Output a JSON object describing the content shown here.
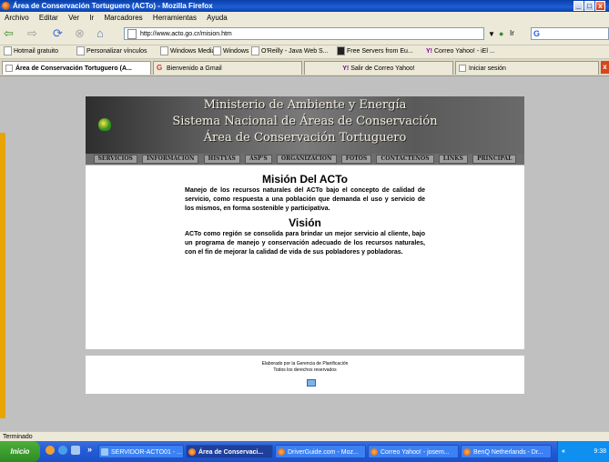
{
  "window": {
    "title": "Área de Conservación Tortuguero (ACTo) - Mozilla Firefox"
  },
  "menubar": {
    "items": [
      "Archivo",
      "Editar",
      "Ver",
      "Ir",
      "Marcadores",
      "Herramientas",
      "Ayuda"
    ]
  },
  "navbar": {
    "url": "http://www.acto.go.cr/mision.htm",
    "go_label": "Ir",
    "search_engine_icon": "google-icon"
  },
  "bookmarks": [
    "Hotmail gratuito",
    "Personalizar vínculos",
    "Windows Media",
    "Windows",
    "O'Reilly - Java Web S...",
    "Free Servers from Eu...",
    "Correo Yahoo! - iEl ..."
  ],
  "tabs": [
    {
      "label": "Área de Conservación Tortuguero (A...",
      "active": true
    },
    {
      "label": "Bienvenido a Gmail",
      "active": false
    },
    {
      "label": "Salir de Correo Yahoo!",
      "active": false
    },
    {
      "label": "Iniciar sesión",
      "active": false
    }
  ],
  "banner": {
    "line1": "Ministerio de Ambiente y Energía",
    "line2": "Sistema Nacional de Áreas de Conservación",
    "line3": "Área de Conservación Tortuguero"
  },
  "site_menu": [
    "SERVICIOS",
    "INFORMACION",
    "HISTYAS",
    "ASP'S",
    "ORGANIZACION",
    "FOTOS",
    "CONTACTENOS",
    "LINKS",
    "PRINCIPAL"
  ],
  "mission": {
    "title": "Misión Del ACTo",
    "text": "Manejo de los recursos naturales del ACTo bajo el concepto de calidad de servicio, como respuesta a una población que demanda el uso y servicio de los mismos, en forma sostenible y participativa."
  },
  "vision": {
    "title": "Visión",
    "text": "ACTo como región se consolida para brindar un mejor servicio al cliente, bajo un programa de manejo y conservación adecuado de los recursos naturales, con el fin de mejorar la calidad de vida de sus pobladores y pobladoras."
  },
  "footer": {
    "line1": "Elaborado por la Gerencia de Planificación",
    "line2": "Todos los derechos reservados"
  },
  "status": {
    "text": "Terminado"
  },
  "taskbar": {
    "start": "Inicio",
    "items": [
      "SERVIDOR-ACTO01 - ...",
      "Área de Conservaci...",
      "DriverGuide.com - Moz...",
      "Correo Yahoo! - josem...",
      "BenQ Netherlands - Dr..."
    ],
    "clock": "9:38"
  },
  "colors": {
    "titlebar": "#0a3fa8",
    "taskbar": "#245edb",
    "accent_strip": "#e8a400",
    "content_bg": "#c0c0c0"
  }
}
